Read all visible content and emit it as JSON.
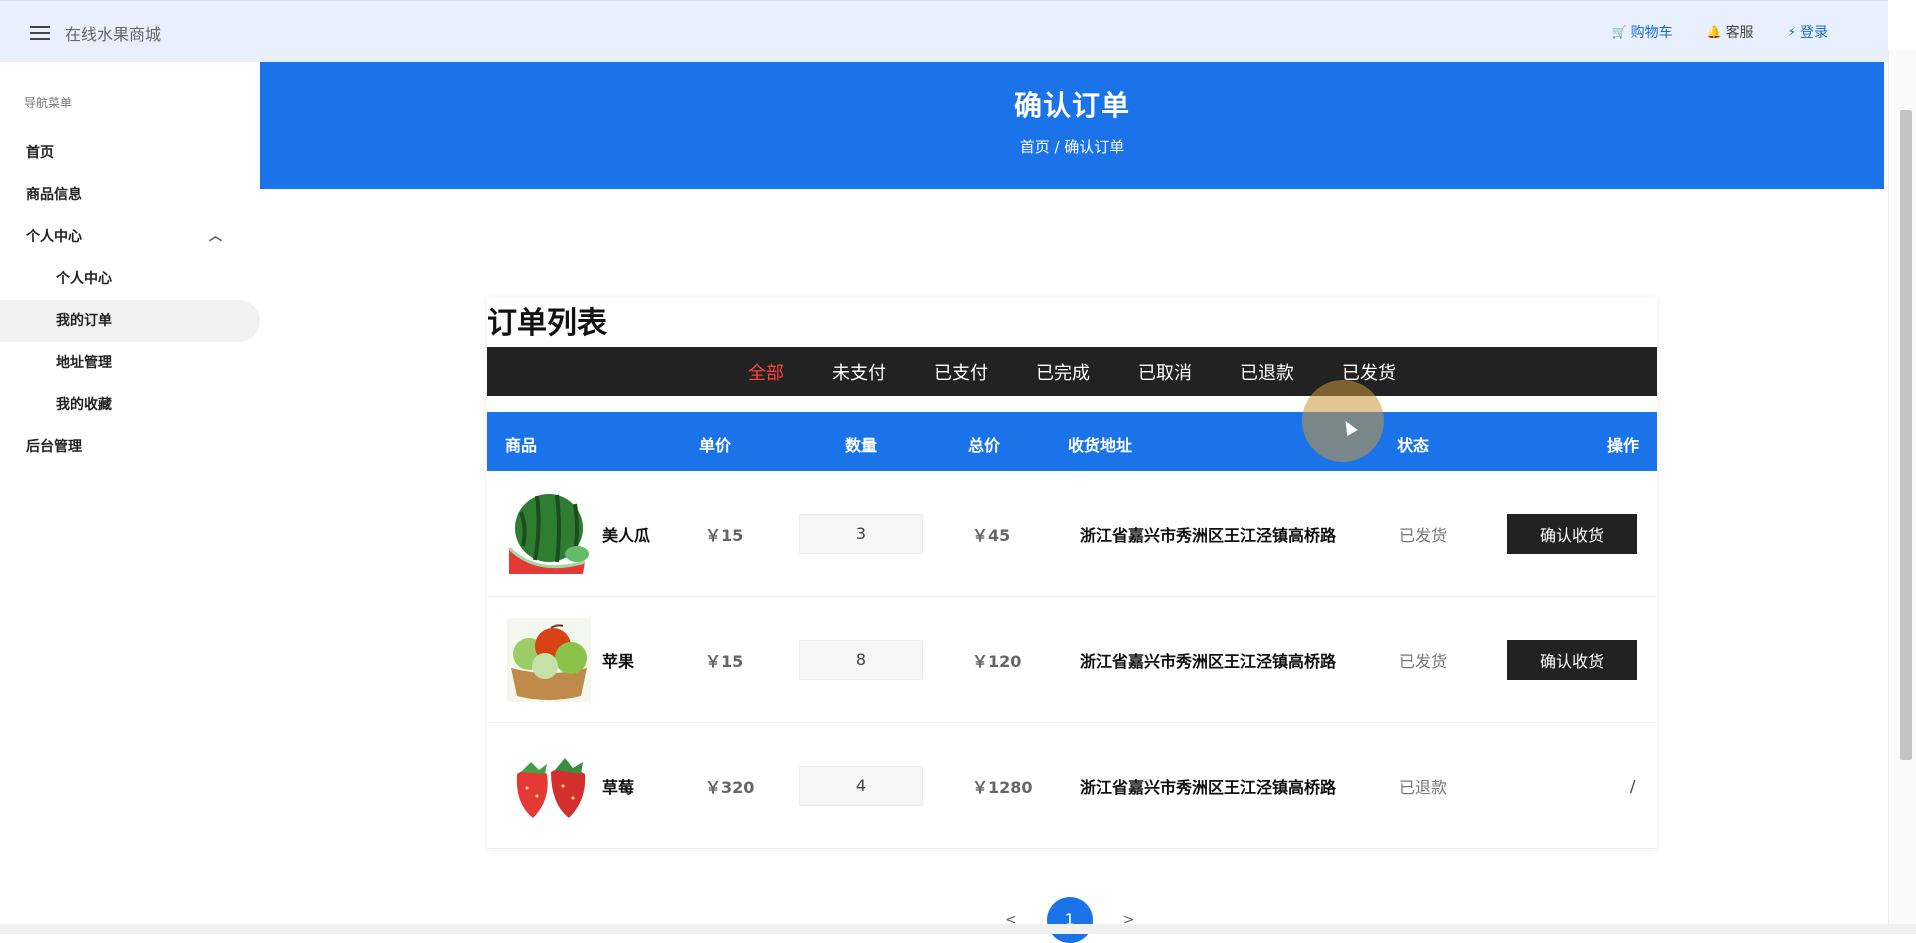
{
  "topbar": {
    "app_title": "在线水果商城",
    "links": [
      {
        "label": "购物车",
        "icon": "cart-icon",
        "glyph": "🛒"
      },
      {
        "label": "客服",
        "icon": "bell-icon",
        "glyph": "🔔"
      },
      {
        "label": "登录",
        "icon": "lightning-icon",
        "glyph": "⚡"
      }
    ]
  },
  "sidebar": {
    "heading": "导航菜单",
    "items": [
      {
        "label": "首页"
      },
      {
        "label": "商品信息"
      },
      {
        "label": "个人中心",
        "expanded": true
      },
      {
        "label": "个人中心",
        "sub": true
      },
      {
        "label": "我的订单",
        "sub": true,
        "active": true
      },
      {
        "label": "地址管理",
        "sub": true
      },
      {
        "label": "我的收藏",
        "sub": true
      },
      {
        "label": "后台管理"
      }
    ]
  },
  "hero": {
    "title": "确认订单",
    "breadcrumb": "首页 / 确认订单"
  },
  "orders": {
    "title": "订单列表",
    "tabs": [
      "全部",
      "未支付",
      "已支付",
      "已完成",
      "已取消",
      "已退款",
      "已发货"
    ],
    "active_tab": "全部",
    "columns": {
      "product": "商品",
      "unit_price": "单价",
      "qty": "数量",
      "total": "总价",
      "address": "收货地址",
      "status": "状态",
      "action": "操作"
    },
    "rows": [
      {
        "name": "美人瓜",
        "price": "￥15",
        "qty": "3",
        "total": "￥45",
        "address": "浙江省嘉兴市秀洲区王江泾镇高桥路",
        "status": "已发货",
        "action": "确认收货",
        "image": "watermelon"
      },
      {
        "name": "苹果",
        "price": "￥15",
        "qty": "8",
        "total": "￥120",
        "address": "浙江省嘉兴市秀洲区王江泾镇高桥路",
        "status": "已发货",
        "action": "确认收货",
        "image": "apple"
      },
      {
        "name": "草莓",
        "price": "￥320",
        "qty": "4",
        "total": "￥1280",
        "address": "浙江省嘉兴市秀洲区王江泾镇高桥路",
        "status": "已退款",
        "action": "/",
        "image": "strawberry"
      }
    ]
  },
  "pager": {
    "prev": "<",
    "page": "1",
    "next": ">"
  },
  "colors": {
    "primary": "#1a73e8",
    "dark": "#222222",
    "active_tab": "#ff4040",
    "topbar": "#e7f0fc"
  }
}
